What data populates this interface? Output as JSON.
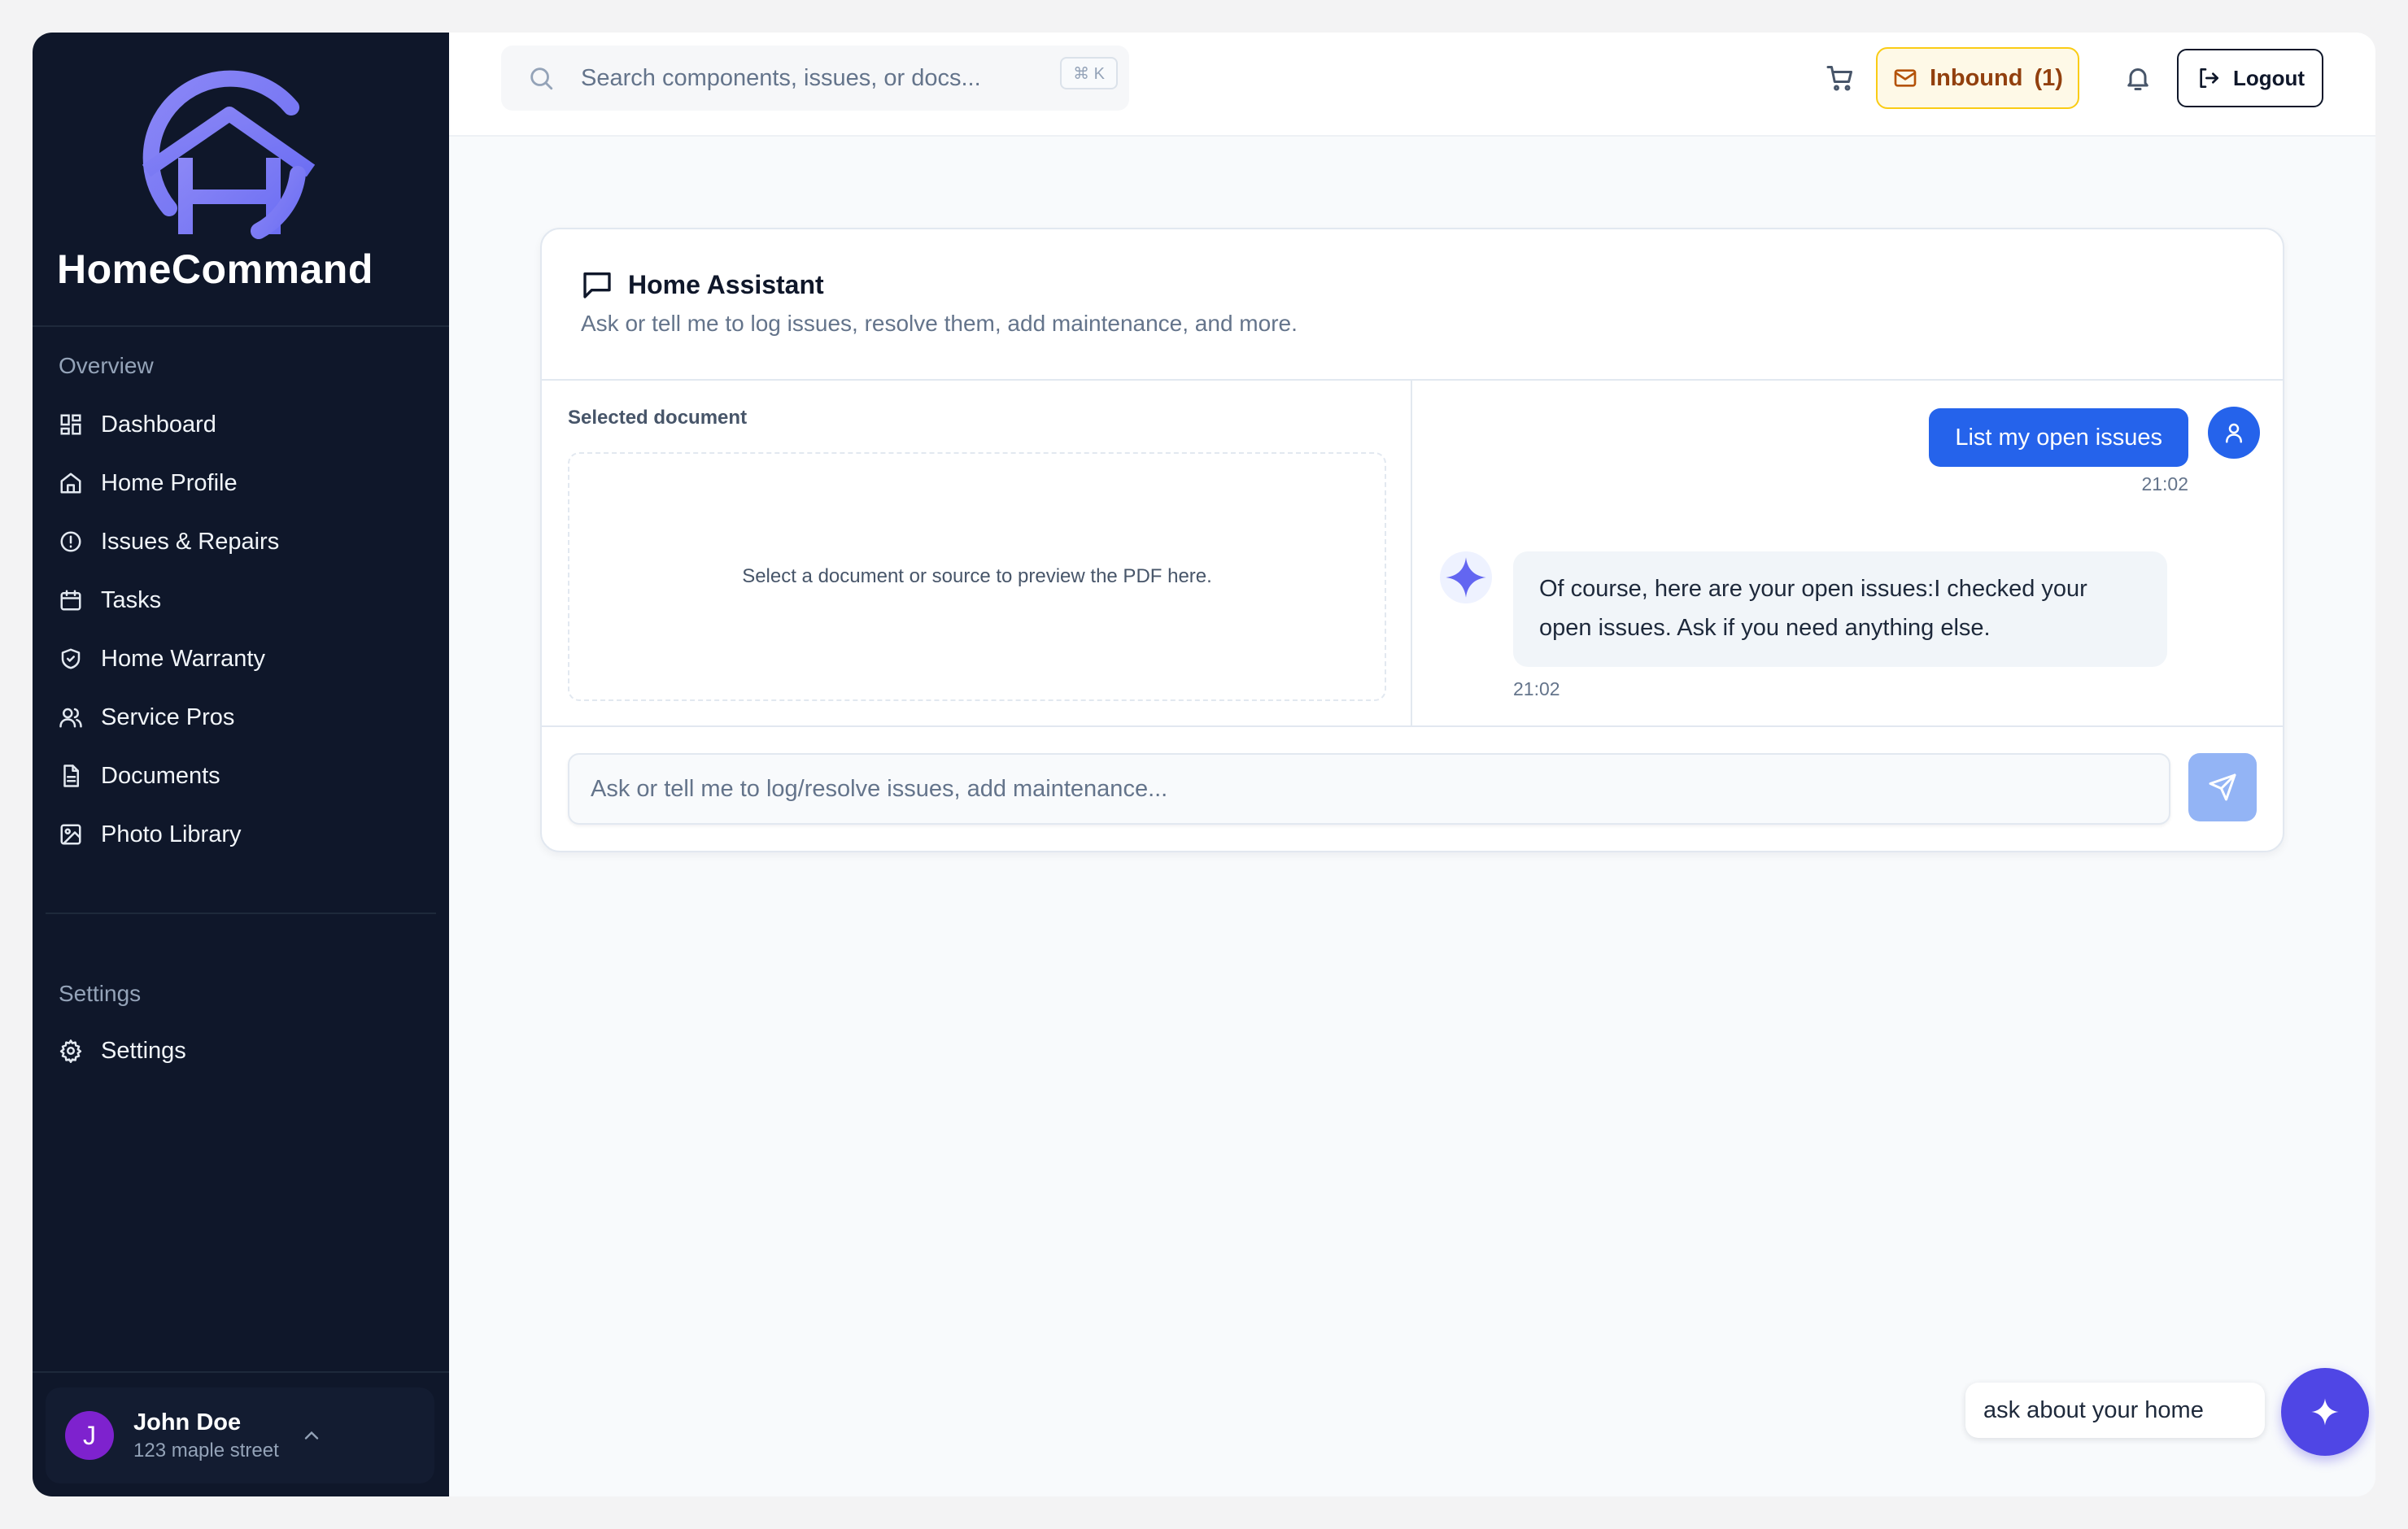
{
  "brand": {
    "name": "HomeCommand",
    "logo_icon": "house-h-logo-icon",
    "accent": "#818cf8"
  },
  "sidebar": {
    "overview_title": "Overview",
    "items": [
      {
        "label": "Dashboard",
        "icon": "dashboard-icon"
      },
      {
        "label": "Home Profile",
        "icon": "home-icon"
      },
      {
        "label": "Issues & Repairs",
        "icon": "alert-circle-icon"
      },
      {
        "label": "Tasks",
        "icon": "calendar-icon"
      },
      {
        "label": "Home Warranty",
        "icon": "shield-check-icon"
      },
      {
        "label": "Service Pros",
        "icon": "users-icon"
      },
      {
        "label": "Documents",
        "icon": "file-text-icon"
      },
      {
        "label": "Photo Library",
        "icon": "image-icon"
      }
    ],
    "settings_title": "Settings",
    "settings_item": {
      "label": "Settings",
      "icon": "gear-icon"
    },
    "user": {
      "initial": "J",
      "name": "John Doe",
      "address": "123 maple street"
    }
  },
  "topbar": {
    "search_placeholder": "Search components, issues, or docs...",
    "shortcut": "⌘ K",
    "inbound_label": "Inbound",
    "inbound_count": "(1)",
    "logout_label": "Logout"
  },
  "assistant": {
    "title": "Home Assistant",
    "subtitle": "Ask or tell me to log issues, resolve them, add maintenance, and more.",
    "doc_label": "Selected document",
    "doc_placeholder": "Select a document or source to preview the PDF here.",
    "messages": [
      {
        "role": "user",
        "text": "List my open issues",
        "time": "21:02"
      },
      {
        "role": "assistant",
        "text": "Of course, here are your open issues:I checked your open issues. Ask if you need anything else.",
        "time": "21:02"
      }
    ],
    "input_placeholder": "Ask or tell me to log/resolve issues, add maintenance..."
  },
  "floating": {
    "ask_label": "ask about your home"
  },
  "colors": {
    "sidebar_bg": "#0f172a",
    "primary": "#2563eb",
    "fab": "#4f46e5",
    "inbound_border": "#facc15"
  }
}
